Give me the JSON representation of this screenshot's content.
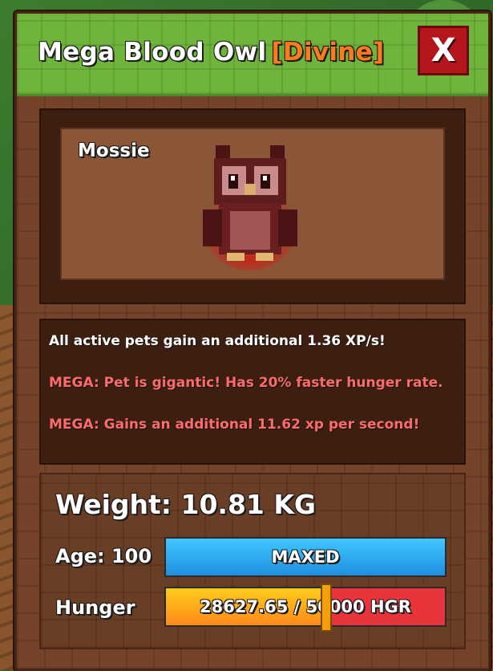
{
  "header": {
    "pet_title": "Mega Blood Owl",
    "rarity": "[Divine]",
    "close_label": "X"
  },
  "preview": {
    "pet_name": "Mossie",
    "pet_icon": "owl-icon"
  },
  "description": {
    "bonus_line": "All active pets gain an additional 1.36 XP/s!",
    "mega_line_1": "MEGA: Pet is gigantic! Has 20% faster hunger rate.",
    "mega_line_2": "MEGA: Gains an additional 11.62 xp per second!"
  },
  "stats": {
    "weight_text": "Weight: 10.81 KG",
    "age_label": "Age: 100",
    "age_bar_text": "MAXED",
    "hunger_label": "Hunger",
    "hunger_bar_text": "28627.65 / 50000 HGR",
    "hunger_fraction": 0.5726
  },
  "colors": {
    "rarity": "#ff7a1e",
    "mega_text": "#ff6b6b",
    "close_bg": "#b4161b",
    "age_bar": "#1f8fe0",
    "hunger_fill": "#ffcc1a",
    "hunger_empty": "#e8343a"
  }
}
